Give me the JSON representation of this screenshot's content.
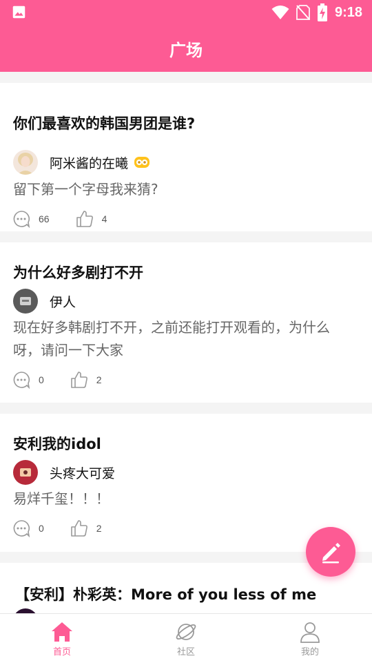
{
  "status_bar": {
    "time": "9:18"
  },
  "app_bar": {
    "title": "广场"
  },
  "posts": [
    {
      "title": "你们最喜欢的韩国男团是谁?",
      "author": "阿米酱的在曦",
      "content": "留下第一个字母我来猜?",
      "comments": "66",
      "likes": "4"
    },
    {
      "title": "为什么好多剧打不开",
      "author": "伊人",
      "content": "现在好多韩剧打不开，之前还能打开观看的，为什么呀，请问一下大家",
      "comments": "0",
      "likes": "2"
    },
    {
      "title": "安利我的idol",
      "author": "头疼大可爱",
      "content": "易烊千玺！！！",
      "comments": "0",
      "likes": "2"
    },
    {
      "title": "【安利】朴彩英：More of you less of me"
    }
  ],
  "tabs": [
    {
      "label": "首页",
      "icon": "home-icon"
    },
    {
      "label": "社区",
      "icon": "planet-icon"
    },
    {
      "label": "我的",
      "icon": "person-icon"
    }
  ],
  "colors": {
    "accent": "#fd5b94"
  }
}
